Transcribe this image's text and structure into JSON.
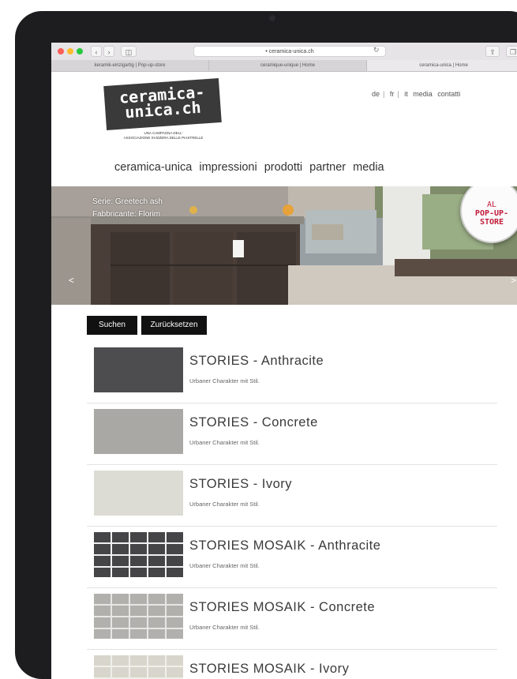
{
  "browser": {
    "url": "ceramica-unica.ch",
    "tabs": [
      {
        "label": "keramik-einzigartig | Pop-up-store"
      },
      {
        "label": "ceramique-unique | Home"
      },
      {
        "label": "ceramica-unica | Home"
      }
    ],
    "new_tab_icon": "+"
  },
  "logo": {
    "line1": "ceramica-",
    "line2": "unica.ch",
    "sub1": "UNA CAMPAGNA DELL'",
    "sub2": "ASSOCIAZIONE SVIZZERA DELLE PIASTRELLE"
  },
  "languages": {
    "items": [
      "de",
      "fr",
      "it"
    ],
    "links": [
      "media",
      "contatti"
    ]
  },
  "nav": [
    "ceramica-unica",
    "impressioni",
    "prodotti",
    "partner",
    "media"
  ],
  "hero": {
    "caption_line1": "Serie: Greetech ash",
    "caption_line2": "Fabbricante: Florim",
    "badge": {
      "line1": "AL",
      "line2": "POP-UP-",
      "line3": "STORE"
    },
    "prev_arrow": "<",
    "next_arrow": ">"
  },
  "buttons": {
    "search": "Suchen",
    "reset": "Zurücksetzen"
  },
  "products": [
    {
      "title": "STORIES - Anthracite",
      "subtitle": "Urbaner Charakter mit Stil.",
      "color": "#4d4d4f"
    },
    {
      "title": "STORIES - Concrete",
      "subtitle": "Urbaner Charakter mit Stil.",
      "color": "#a9a8a4"
    },
    {
      "title": "STORIES - Ivory",
      "subtitle": "Urbaner Charakter mit Stil.",
      "color": "#dcdcd4"
    },
    {
      "title": "STORIES MOSAIK - Anthracite",
      "subtitle": "Urbaner Charakter mit Stil.",
      "color": "#454547"
    },
    {
      "title": "STORIES MOSAIK - Concrete",
      "subtitle": "Urbaner Charakter mit Stil.",
      "color": "#b1b0ac"
    },
    {
      "title": "STORIES MOSAIK - Ivory",
      "subtitle": "",
      "color": "#d8d6cc"
    }
  ],
  "colors": {
    "badge_red": "#c21d3a",
    "button_bg": "#111111"
  }
}
